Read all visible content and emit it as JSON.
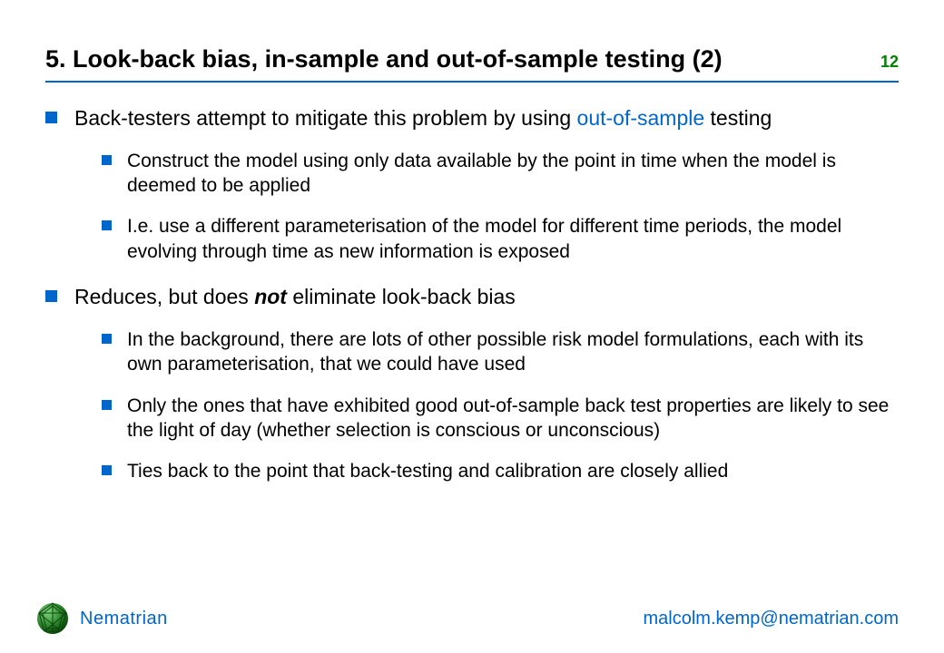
{
  "header": {
    "title": "5. Look-back bias, in-sample and out-of-sample testing (2)",
    "page_number": "12"
  },
  "content": {
    "bullets": [
      {
        "text_before": "Back-testers attempt to mitigate this problem by using ",
        "highlight": "out-of-sample",
        "text_after": " testing",
        "sub": [
          "Construct the model using only data available by the point in time when the model is deemed to be applied",
          "I.e. use a different parameterisation of the model for different time periods, the model evolving through time as new information is exposed"
        ]
      },
      {
        "text_before": "Reduces, but does ",
        "emph": "not",
        "text_after": " eliminate look-back bias",
        "sub": [
          "In the background, there are lots of other possible risk model formulations, each with its own parameterisation, that we could have used",
          "Only the ones that have exhibited good out-of-sample back test properties are likely to see the light of day (whether selection is conscious or unconscious)",
          "Ties back to the point that back-testing and calibration are closely allied"
        ]
      }
    ]
  },
  "footer": {
    "brand": "Nematrian",
    "contact": "malcolm.kemp@nematrian.com"
  }
}
